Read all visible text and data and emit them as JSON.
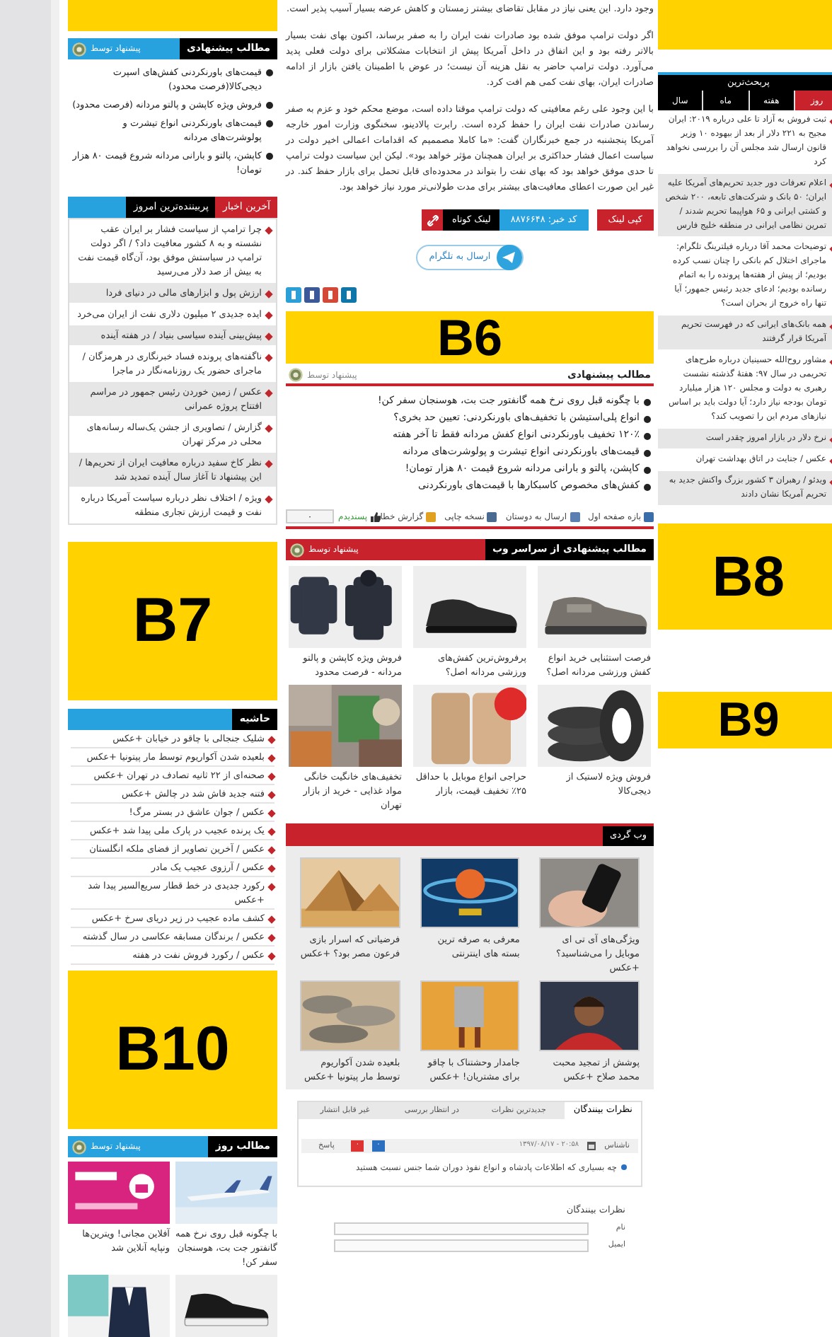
{
  "left": {
    "suggested": {
      "title": "مطالب پیشنهادی",
      "provider": "پیشنهاد توسط",
      "items": [
        "قیمت‌های باورنکردنی کفش‌های اسپرت دیجی‌کالا(فرصت محدود)",
        "فروش ویژه کاپشن و پالتو مردانه (فرصت محدود)",
        "قیمت‌های باورنکردنی انواع تیشرت و پولوشرت‌های مردانه",
        "کاپشن، پالتو و بارانی مردانه شروع قیمت ۸۰ هزار تومان!"
      ]
    },
    "news": {
      "tabs": [
        {
          "label": "آخرین اخبار",
          "selected": true
        },
        {
          "label": "پربیننده‌ترین امروز",
          "selected": false
        }
      ],
      "items": [
        "چرا ترامپ از سیاست فشار بر ایران عقب نشسته و به ۸ کشور معافیت داد؟ / اگر دولت ترامپ در سیاستش موفق بود، آن‌گاه قیمت نفت به بیش از صد دلار می‌رسید",
        "ارزش پول و ابزارهای مالی در دنیای فردا",
        "ایده جدیدی ۲ میلیون دلاری نفت از ایران می‌خرد",
        "پیش‌بینی آینده سیاسی بنیاد / در هفته آینده",
        "ناگفته‌های پرونده فساد خبرنگاری در هرمزگان / ماجرای حضور یک روزنامه‌نگار در ماجرا",
        "عکس / زمین خوردن رئیس جمهور در مراسم افتتاح پروژه عمرانی",
        "گزارش / تصاویری از جشن یک‌ساله رسانه‌های محلی در مرکز تهران",
        "نظر کاخ سفید درباره معافیت ایران از تحریم‌ها / این پیشنهاد تا آغاز سال آینده تمدید شد",
        "ویژه / اختلاف نظر درباره سیاست آمریکا درباره نفت و قیمت ارزش تجاری منطقه"
      ]
    },
    "ad_b7": "B7",
    "margin": {
      "title": "حاشیه",
      "items": [
        "شلیک جنجالی با چاقو در خیابان +عکس",
        "بلعیده شدن آکواریوم توسط مار پیتونیا +عکس",
        "صحنه‌ای از ۲۲ ثانیه تصادف در تهران +عکس",
        "فتنه جدید فاش شد در چالش +عکس",
        "عکس / جوان عاشق در بستر مرگ!",
        "یک پرنده عجیب در پارک ملی پیدا شد +عکس",
        "عکس / آخرین تصاویر از فضای ملکه انگلستان",
        "عکس / آرزوی عجیب یک مادر",
        "رکورد جدیدی در خط قطار سریع‌السیر پیدا شد +عکس",
        "کشف ماده عجیب در زیر دریای سرخ +عکس",
        "عکس / برندگان مسابقه عکاسی در سال گذشته",
        "عکس / رکورد فروش نفت در هفته"
      ]
    },
    "ad_b10": "B10",
    "daily": {
      "title": "مطالب روز",
      "provider": "پیشنهاد توسط",
      "cards": [
        {
          "caption": "با چگونه قبل روی نرخ همه گانفتور جت بت، هوسنجان سفر کن!"
        },
        {
          "caption": "آفلاین مجانی! ویترین‌ها ونپایه آنلاین شد"
        },
        {
          "kind": "picture"
        },
        {
          "kind": "picture"
        }
      ]
    }
  },
  "main": {
    "article": [
      "وجود دارد. این یعنی نیاز در مقابل تقاضای بیشتر زمستان و کاهش عرضه بسیار آسیب پذیر است.",
      "اگر دولت ترامپ موفق شده بود صادرات نفت ایران را به صفر برساند، اکنون بهای نفت بسیار بالاتر رفته بود و این اتفاق در داخل آمریکا پیش از انتخابات مشکلاتی برای دولت فعلی پدید می‌آورد. دولت ترامپ حاضر به نقل هزینه آن نیست؛ در عوض با اطمینان یافتن بازار از ادامه صادرات ایران، بهای نفت کمی هم افت کرد.",
      "با این وجود علی رغم معافیتی که دولت ترامپ موقتا داده است، موضع محکم خود و عزم به صفر رساندن صادرات نفت ایران را حفظ کرده است. رابرت پالادینو، سخنگوی وزارت امور خارجه آمریکا پنجشنبه در جمع خبرنگاران گفت: «ما کاملا مصممیم که اقدامات اعمالی اخیر دولت در سیاست اعمال فشار حداکثری بر ایران همچنان مؤثر خواهد بود». لیکن این سیاست دولت ترامپ تا حدی موفق خواهد بود که بهای نفت را بتواند در محدوده‌ای قابل تحمل برای بازار حفظ کند. در غیر این صورت اعطای معافیت‌های بیشتر برای مدت طولانی‌تر مورد نیاز خواهد بود."
    ],
    "actions": {
      "copy_link": "کپی لینک",
      "news_code": "کد خبر: ۸۸۷۶۶۴۸",
      "short_link": "لینک کوتاه"
    },
    "telegram": "ارسال به تلگرام",
    "ad_b6": "B6",
    "suggested": {
      "title": "مطالب پیشنهادی",
      "provider": "پیشنهاد توسط",
      "items": [
        "با چگونه قبل روی نرخ همه گانفتور جت بت، هوسنجان سفر کن!",
        "انواع پلی‌استیشن با تخفیف‌های باورنکردنی: تعیین حد بخری؟",
        "۱۲۰٪ تخفیف باورنکردنی انواع کفش مردانه فقط تا آخر هفته",
        "قیمت‌های باورنکردنی انواع تیشرت و پولوشرت‌های مردانه",
        "کاپشن، پالتو و بارانی مردانه شروع قیمت ۸۰ هزار تومان!",
        "کفش‌های مخصوص کاسبکارها با قیمت‌های باورنکردنی"
      ]
    },
    "tools": [
      "بازه صفحه اول",
      "ارسال به دوستان",
      "نسخه چاپی",
      "گزارش خطا"
    ],
    "like": {
      "label": "پسندیدم",
      "count": "۰"
    },
    "web": {
      "title": "مطالب پیشنهادی از سراسر وب",
      "provider": "پیشنهاد توسط",
      "items": [
        "فرصت استثنایی خرید انواع کفش ورزشی مردانه اصل؟",
        "پرفروش‌ترین کفش‌های ورزشی مردانه اصل؟",
        "فروش ویژه کاپشن و پالتو مردانه - فرصت محدود",
        "فروش ویژه لاستیک از دیجی‌کالا",
        "حراجی انواع موبایل با حداقل ۲۵٪ تخفیف قیمت، بازار",
        "تخفیف‌های خانگیت خانگی مواد غذایی - خرید از بازار تهران"
      ]
    },
    "surf": {
      "title": "وب گردی",
      "items": [
        "ویژگی‌های آی تی ای موبایل را می‌شناسید؟ +عکس",
        "معرفی به صرفه ترین بسته های اینترنتی",
        "فرضیاتی که اسرار بازی فرعون مصر بود؟ +عکس",
        "پوشش از تمجید محبت محمد صلاح +عکس",
        "جامدار وحشتناک با چاقو برای مشتریان! +عکس",
        "بلعیده شدن آکواریوم توسط مار پیتونیا +عکس"
      ]
    },
    "comments": {
      "title": "نظرات بینندگان",
      "filters": [
        "جدیدترین نظرات",
        "در انتظار بررسی",
        "غیر قابل انتشار"
      ],
      "comment": {
        "author": "ناشناس",
        "date": "۲۰:۵۸ - ۱۳۹۷/۰۸/۱۷",
        "likes": "۰",
        "dislikes": "۰",
        "reply": "پاسخ",
        "text": "چه بسیاری که اطلاعات پادشاه و انواع نفوذ دوران شما جنس نسبت هستید"
      },
      "form_title": "نظرات بینندگان",
      "fields": [
        {
          "label": "نام"
        },
        {
          "label": "ایمیل"
        }
      ]
    }
  },
  "right": {
    "title": "پربحث‌ترین",
    "tabs": [
      {
        "label": "روز",
        "selected": true
      },
      {
        "label": "هفته",
        "selected": false
      },
      {
        "label": "ماه",
        "selected": false
      },
      {
        "label": "سال",
        "selected": false
      }
    ],
    "items": [
      "ثبت فروش به آزاد تا علی درباره ۲۰۱۹: ایران مجیح به ۲۲۱ دلار از بعد از بیهوده ۱۰ وزیر قانون ارسال شد مجلس آن را بررسی نخواهد کرد",
      "اعلام تعرفات دور جدید تحریم‌های آمریکا علیه ایران؛ ۵۰ بانک و شرکت‌های تابعه، ۲۰۰ شخص و کشتی ایرانی و ۶۵ هواپیما تحریم شدند / تمرین نظامی ایرانی در منطقه خلیج فارس",
      "توضیحات محمد آقا درباره فیلترینگ تلگرام: ماجرای اختلال کم بانکی را چنان نسب کرده بودیم؛ از پیش از هفته‌ها پرونده را به اتمام رسانده بودیم؛ ادعای جدید رئیس جمهور؛ آیا تنها راه خروج از بحران است؟",
      "همه بانک‌های ایرانی که در فهرست تحریم آمریکا قرار گرفتند",
      "مشاور روح‌الله حسینیان درباره طرح‌های تحریمی در سال ۹۷: هفتهٔ گذشته نشست رهبری به دولت و مجلس ۱۲۰ هزار میلیارد تومان بودجه نیاز دارد؛ آیا دولت باید بر اساس نیازهای مردم این را تصویب کند؟",
      "نرخ دلار در بازار امروز چقدر است",
      "عکس / جنایت در اتاق بهداشت تهران",
      "ویدئو / رهبران ۳ کشور بزرگ واکنش جدید به تحریم آمریکا نشان دادند"
    ],
    "ad_b8": "B8",
    "ad_b9": "B9"
  }
}
